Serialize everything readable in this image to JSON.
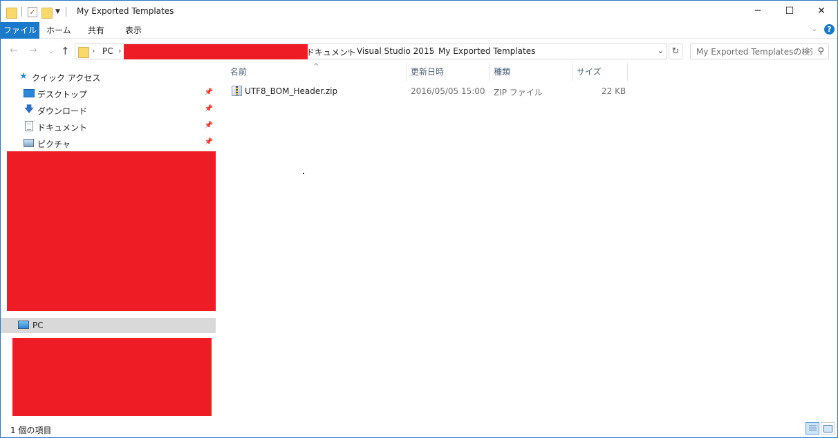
{
  "window": {
    "title": "My Exported Templates",
    "controls": {
      "minimize": "─",
      "maximize": "☐",
      "close": "✕"
    }
  },
  "ribbon": {
    "tabs": [
      "ファイル",
      "ホーム",
      "共有",
      "表示"
    ],
    "help": "?"
  },
  "navigation": {
    "back": "←",
    "forward": "→",
    "recent": "⌄",
    "up": "↑",
    "breadcrumb": {
      "root": "PC",
      "documents": "ドキュメント",
      "visual_studio": "Visual Studio 2015",
      "current": "My Exported Templates"
    },
    "refresh": "↻",
    "search_placeholder": "My Exported Templatesの検索"
  },
  "nav_pane": {
    "quick_access": "クイック アクセス",
    "items": [
      {
        "label": "デスクトップ",
        "icon": "desktop-icon",
        "pinned": true
      },
      {
        "label": "ダウンロード",
        "icon": "download-icon",
        "pinned": true
      },
      {
        "label": "ドキュメント",
        "icon": "documents-icon",
        "pinned": true
      },
      {
        "label": "ピクチャ",
        "icon": "pictures-icon",
        "pinned": true
      }
    ],
    "pc": "PC",
    "redaction_color": "#ee1c25"
  },
  "file_list": {
    "columns": [
      "名前",
      "更新日時",
      "種類",
      "サイズ"
    ],
    "sort_indicator": "^",
    "rows": [
      {
        "name": "UTF8_BOM_Header.zip",
        "modified": "2016/05/05 15:00",
        "type": "ZIP ファイル",
        "size": "22 KB",
        "icon": "zip-file-icon"
      }
    ]
  },
  "status": {
    "item_count": "1 個の項目"
  },
  "colors": {
    "accent": "#1979ca",
    "selection": "#d9d9d9",
    "redaction": "#ee1c25"
  }
}
